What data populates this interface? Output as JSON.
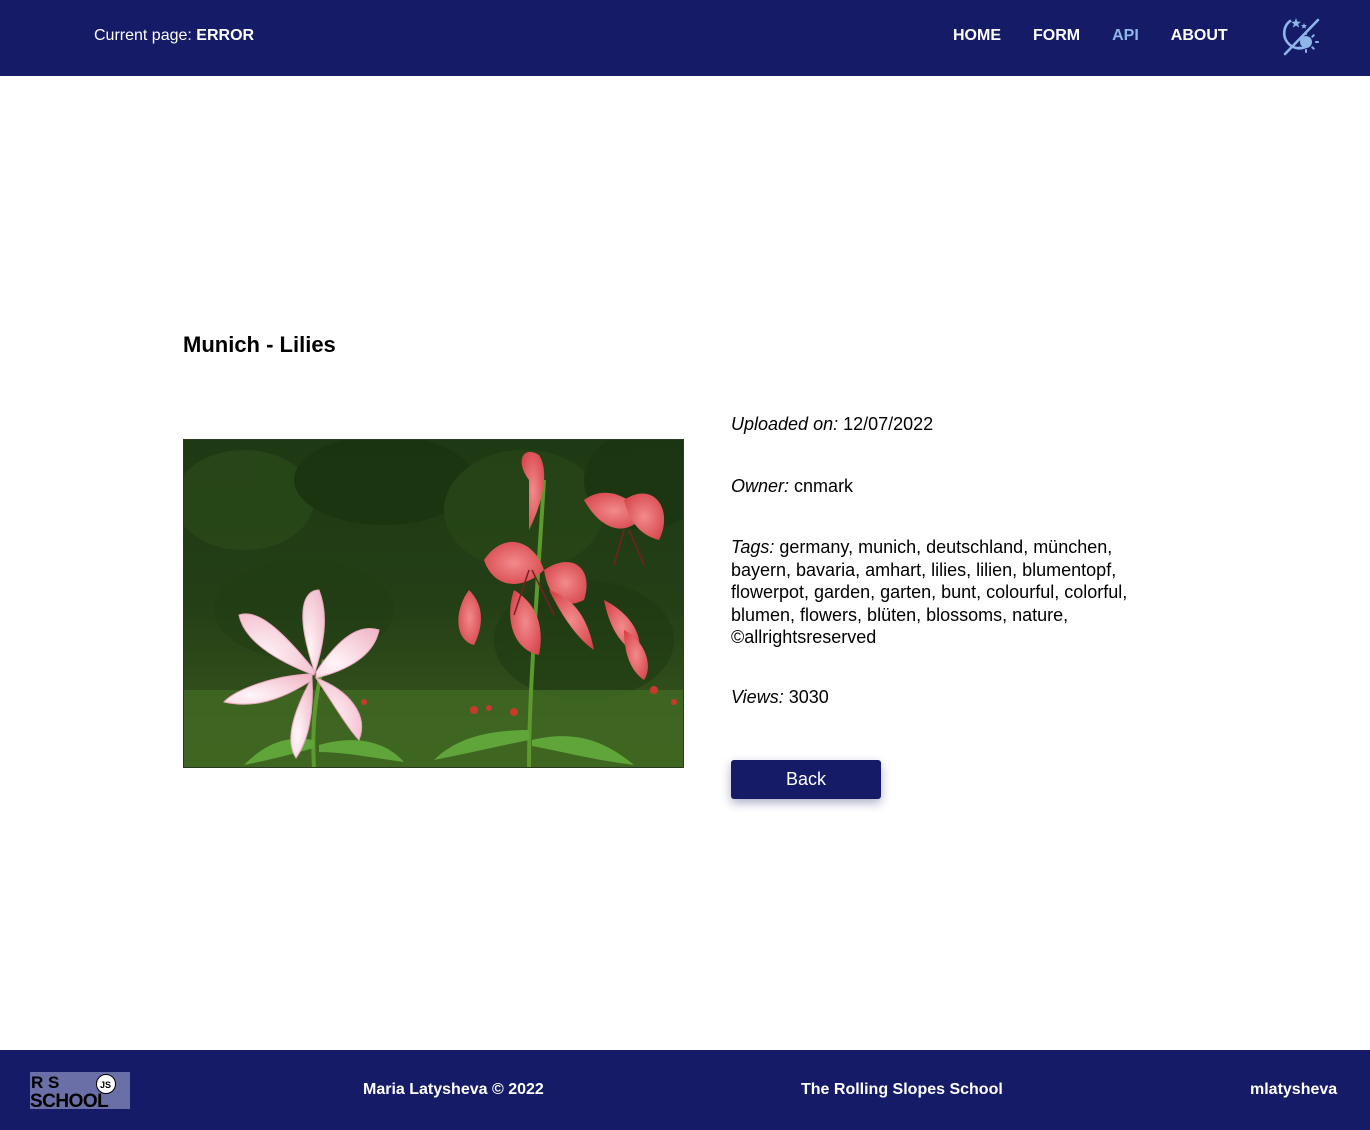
{
  "header": {
    "current_page_label": "Current page:",
    "current_page_value": "ERROR",
    "nav": [
      {
        "label": "HOME",
        "active": false
      },
      {
        "label": "FORM",
        "active": false
      },
      {
        "label": "API",
        "active": true
      },
      {
        "label": "ABOUT",
        "active": false
      }
    ],
    "theme_icon": "theme-toggle-sun-moon-icon"
  },
  "card": {
    "title": "Munich - Lilies",
    "uploaded_label": "Uploaded on:",
    "uploaded_value": "12/07/2022",
    "owner_label": "Owner:",
    "owner_value": "cnmark",
    "tags_label": "Tags:",
    "tags_value": "germany, munich, deutschland, münchen, bayern, bavaria, amhart, lilies, lilien, blumentopf, flowerpot, garden, garten, bunt, colourful, colorful, blumen, flowers, blüten, blossoms, nature, ©allrightsreserved",
    "views_label": "Views:",
    "views_value": "3030",
    "back_label": "Back"
  },
  "footer": {
    "logo_text_top": "R  S",
    "logo_text_bottom": "SCHOOL",
    "logo_badge": "JS",
    "copyright": "Maria Latysheva © 2022",
    "school": "The Rolling Slopes School",
    "github": "mlatysheva"
  },
  "colors": {
    "primary": "#151b66",
    "nav_active": "#8fb6ea",
    "background": "#ffffff"
  }
}
